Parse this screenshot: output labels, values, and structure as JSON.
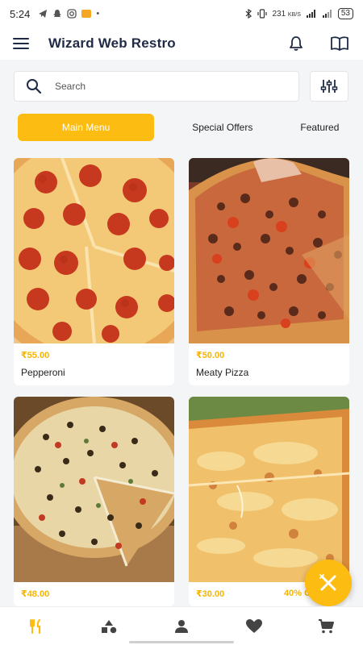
{
  "status_bar": {
    "time": "5:24",
    "network_speed": "231",
    "network_unit": "KB/S",
    "battery": "53"
  },
  "app_bar": {
    "title": "Wizard Web Restro",
    "icons": [
      "menu-icon",
      "bell-icon",
      "book-icon"
    ]
  },
  "search": {
    "placeholder": "Search",
    "value": ""
  },
  "tabs": [
    {
      "label": "Main Menu",
      "active": true
    },
    {
      "label": "Special Offers",
      "active": false
    },
    {
      "label": "Featured",
      "active": false
    }
  ],
  "products": [
    {
      "price": "₹55.00",
      "name": "Pepperoni",
      "offer": ""
    },
    {
      "price": "₹50.00",
      "name": "Meaty Pizza",
      "offer": ""
    },
    {
      "price": "₹48.00",
      "name": "",
      "offer": ""
    },
    {
      "price": "₹30.00",
      "name": "",
      "offer": "40% Off"
    }
  ],
  "fab": {
    "icon": "utensils-cross-icon"
  },
  "bottom_nav": [
    "utensils-icon",
    "categories-icon",
    "profile-icon",
    "heart-icon",
    "cart-icon"
  ],
  "colors": {
    "accent": "#fdbc12",
    "title": "#1f2a44",
    "price": "#f6b400"
  }
}
